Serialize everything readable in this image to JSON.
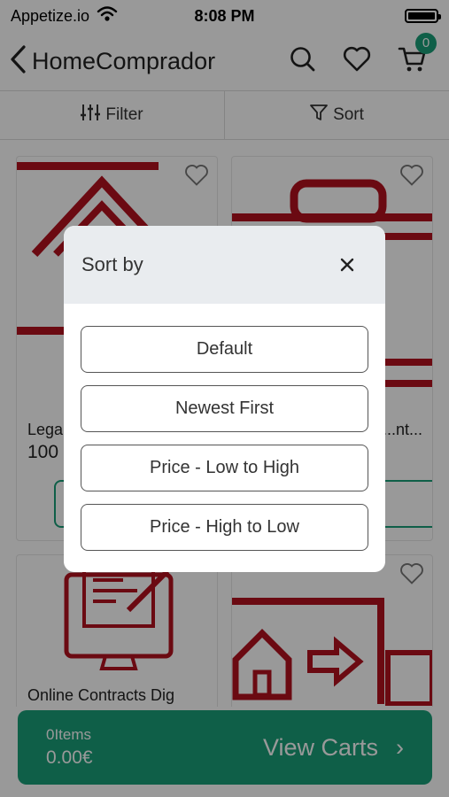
{
  "status_bar": {
    "carrier": "Appetize.io",
    "time": "8:08 PM",
    "wifi_icon": "wifi-icon",
    "battery_icon": "battery-icon"
  },
  "nav": {
    "title": "HomeComprador",
    "back_icon": "chevron-left-icon",
    "search_icon": "search-icon",
    "favorites_icon": "heart-icon",
    "cart_icon": "cart-icon",
    "cart_count": "0"
  },
  "toolbar": {
    "filter_label": "Filter",
    "sort_label": "Sort"
  },
  "products": [
    {
      "name": "Lega",
      "price": "100"
    },
    {
      "name": "...nt...",
      "price": ""
    },
    {
      "name": "Online Contracts Dig",
      "price": ""
    },
    {
      "name": "",
      "price": ""
    }
  ],
  "bottom_bar": {
    "items_label": "0Items",
    "total": "0.00€",
    "view_label": "View Carts",
    "chevron": "›"
  },
  "modal": {
    "title": "Sort by",
    "close_icon": "close-icon",
    "options": [
      "Default",
      "Newest First",
      "Price - Low to High",
      "Price - High to Low"
    ]
  },
  "colors": {
    "accent": "#199e78",
    "illustration": "#b3121f",
    "overlay": "rgba(0,0,0,0.4)"
  }
}
